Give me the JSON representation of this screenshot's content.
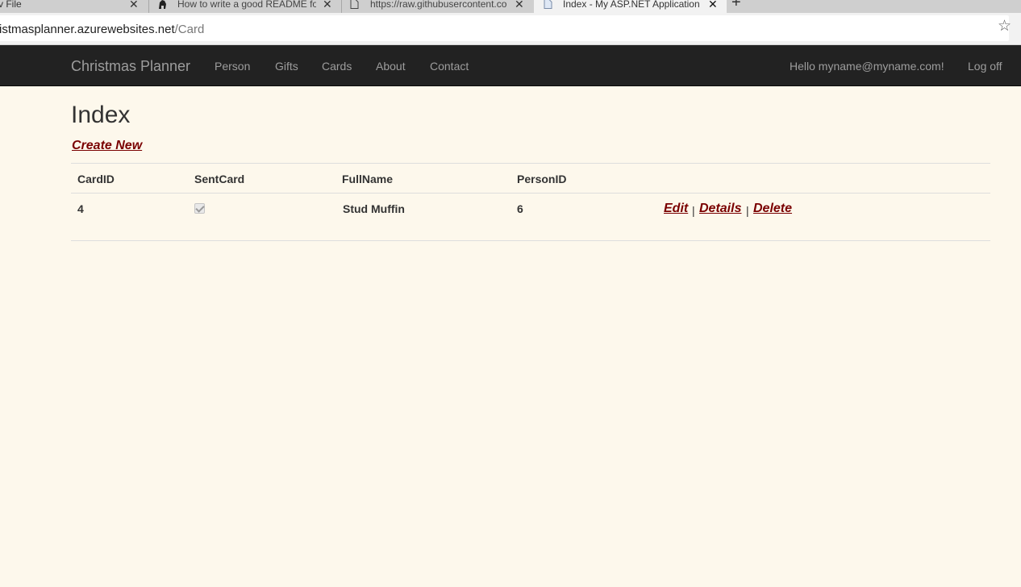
{
  "browser": {
    "tabs": [
      {
        "title": "v File"
      },
      {
        "title": "How to write a good README fo"
      },
      {
        "title": "https://raw.githubusercontent.co"
      },
      {
        "title": "Index - My ASP.NET Application"
      }
    ],
    "tab_close": "✕",
    "new_tab": "+",
    "url_host": "ristmasplanner.azurewebsites.net",
    "url_path": "/Card",
    "bookmark": "☆"
  },
  "navbar": {
    "brand": "Christmas Planner",
    "links": [
      "Person",
      "Gifts",
      "Cards",
      "About",
      "Contact"
    ],
    "greeting": "Hello myname@myname.com!",
    "logoff": "Log off"
  },
  "main": {
    "title": "Index",
    "create_new": "Create New",
    "table": {
      "headers": [
        "CardID",
        "SentCard",
        "FullName",
        "PersonID"
      ],
      "rows": [
        {
          "card_id": "4",
          "sent_card": true,
          "full_name": "Stud Muffin",
          "person_id": "6"
        }
      ],
      "actions": [
        "Edit",
        "Details",
        "Delete"
      ],
      "separator": "|"
    }
  },
  "colors": {
    "page_bg": "#fdf8ec",
    "navbar_bg": "#222222",
    "link": "#7a0000"
  }
}
